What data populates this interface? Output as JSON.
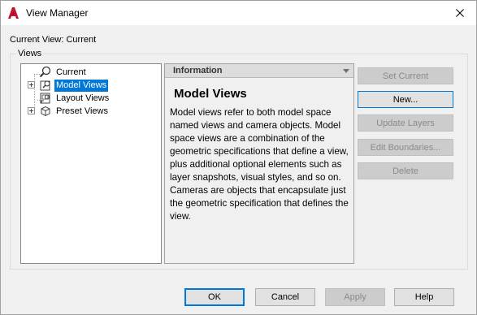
{
  "window": {
    "title": "View Manager",
    "app_icon": "autocad-icon",
    "close_icon": "close-icon"
  },
  "current_view": "Current View: Current",
  "group_label": "Views",
  "tree": {
    "items": [
      {
        "label": "Current",
        "icon": "magnifier-icon",
        "expandable": false,
        "selected": false
      },
      {
        "label": "Model Views",
        "icon": "model-views-icon",
        "expandable": true,
        "selected": true
      },
      {
        "label": "Layout Views",
        "icon": "layout-views-icon",
        "expandable": false,
        "selected": false
      },
      {
        "label": "Preset Views",
        "icon": "preset-views-icon",
        "expandable": true,
        "selected": false
      }
    ]
  },
  "info": {
    "header": "Information",
    "title": "Model Views",
    "body": "Model views refer to both model space named views and camera objects. Model space views are a combination of the geometric specifications that define a view, plus additional optional elements such as layer snapshots, visual styles, and so on. Cameras are objects that encapsulate just the geometric specification that defines the view."
  },
  "side_buttons": {
    "set_current": "Set Current",
    "new": "New...",
    "update_layers": "Update Layers",
    "edit_boundaries": "Edit Boundaries...",
    "delete": "Delete"
  },
  "bottom_buttons": {
    "ok": "OK",
    "cancel": "Cancel",
    "apply": "Apply",
    "help": "Help"
  },
  "colors": {
    "selection": "#0078d7",
    "brand": "#c8102e"
  }
}
